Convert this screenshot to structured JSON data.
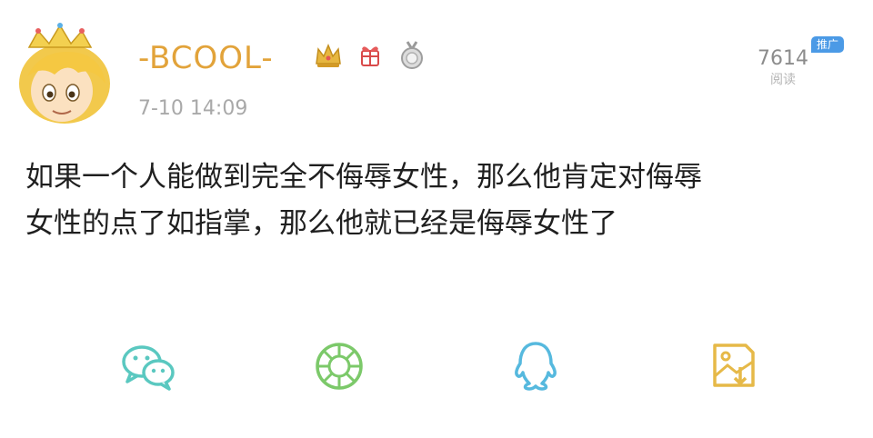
{
  "post": {
    "username": "-BCOOL-",
    "timestamp": "7-10 14:09",
    "read_count": "7614",
    "read_label": "阅读",
    "promote_tag": "推广",
    "content": "如果一个人能做到完全不侮辱女性，那么他肯定对侮辱\n女性的点了如指掌，那么他就已经是侮辱女性了"
  },
  "colors": {
    "username": "#e2a33a",
    "timestamp": "#a9a9a9",
    "share_icon": "#5ac8c0",
    "share_icon_save": "#e6b948",
    "promote_tag": "#4b9ae6"
  },
  "share_icons": [
    "wechat-icon",
    "moments-icon",
    "qq-icon",
    "save-image-icon"
  ]
}
